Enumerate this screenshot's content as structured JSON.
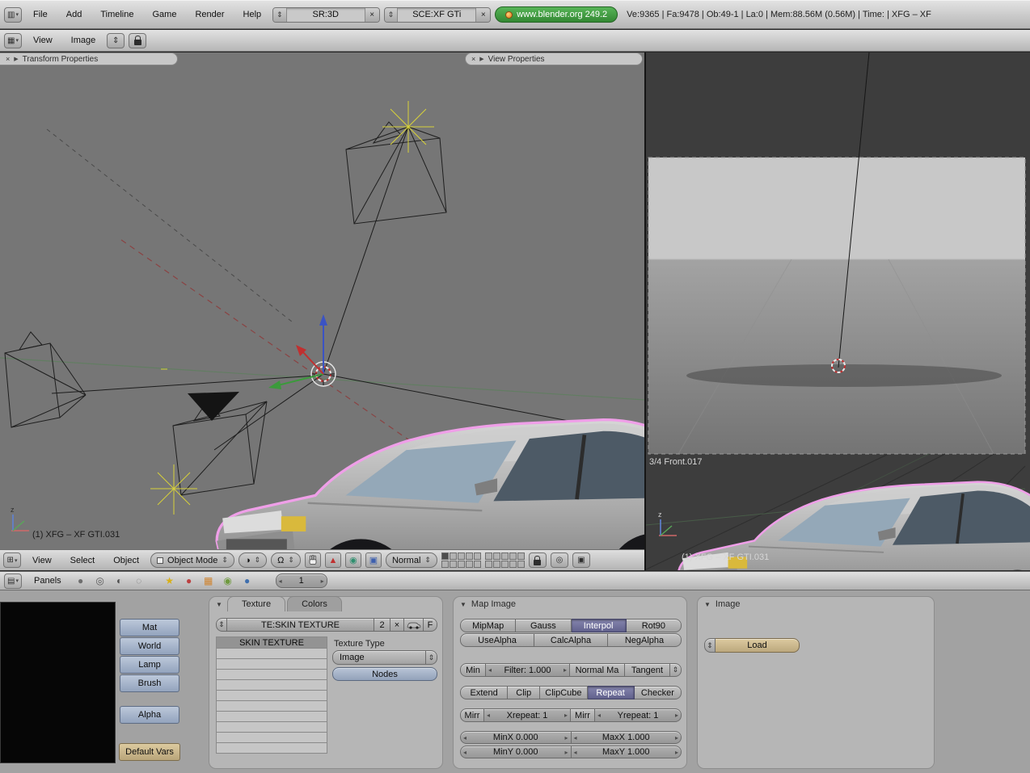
{
  "colors": {
    "header_gray": "#cfcfcf",
    "viewport_gray": "#767676",
    "image_editor_bg": "#3d3d3d",
    "buttons_area_bg": "#a2a2a2",
    "panel_bg": "#b6b6b6",
    "active_toggle": "#62628e",
    "badge_green": "#338833",
    "file_button_tan": "#c9b78e",
    "side_button_blue": "#a3b2cb",
    "selection_outline_pink": "#ef9fe8"
  },
  "icons": {
    "close": "×",
    "collapse": "▼",
    "expand": "▶",
    "stepper": "⇕",
    "dropdown": "▾",
    "info_editor": "▥",
    "image_editor": "▦",
    "view3d_editor": "⊞",
    "buttons_editor": "▤",
    "draw_type": "◑",
    "pivot": "Ω",
    "translate": "▲",
    "rotate": "◉",
    "scale": "▣",
    "proportional": "◎",
    "render_overlay": "▣",
    "logic_ctx": "●",
    "script_ctx": "◎",
    "shading_ctx": "◐",
    "object_ctx": "◌",
    "lamp_ctx": "★",
    "material_ctx": "●",
    "texture_ctx": "▦",
    "radiosity_ctx": "◉",
    "world_ctx": "●"
  },
  "top_header": {
    "menus": [
      {
        "label": "File"
      },
      {
        "label": "Add"
      },
      {
        "label": "Timeline"
      },
      {
        "label": "Game"
      },
      {
        "label": "Render"
      },
      {
        "label": "Help"
      }
    ],
    "screen_field": "SR:3D",
    "scene_field": "SCE:XF GTi",
    "version_badge": "www.blender.org 249.2",
    "stats": "Ve:9365 | Fa:9478 | Ob:49-1 | La:0 | Mem:88.56M (0.56M) | Time: | XFG – XF"
  },
  "image_header": {
    "menus": [
      {
        "label": "View"
      },
      {
        "label": "Image"
      }
    ]
  },
  "viewport3d": {
    "transform_properties_title": "Transform Properties",
    "view_properties_title": "View Properties",
    "object_label": "(1) XFG – XF GTI.031",
    "header": {
      "menus": [
        {
          "label": "View"
        },
        {
          "label": "Select"
        },
        {
          "label": "Object"
        }
      ],
      "mode": "Object Mode",
      "orientation": "Normal"
    }
  },
  "image_editor": {
    "caption": "3/4 Front.017",
    "object_label": "(1) XFG – XF GTI.031"
  },
  "buttons_header": {
    "panels_label": "Panels",
    "frame": "1"
  },
  "sidebar": {
    "buttons": [
      {
        "label": "Mat"
      },
      {
        "label": "World"
      },
      {
        "label": "Lamp"
      },
      {
        "label": "Brush"
      }
    ],
    "alpha": "Alpha",
    "default_vars": "Default Vars"
  },
  "texture_panel": {
    "tabs": [
      {
        "label": "Texture"
      },
      {
        "label": "Colors"
      }
    ],
    "datablock": {
      "name": "TE:SKIN TEXTURE",
      "users": "2",
      "fake_user": "F"
    },
    "selected_slot": "SKIN TEXTURE",
    "texture_type_label": "Texture Type",
    "texture_type": "Image",
    "nodes": "Nodes"
  },
  "map_image_panel": {
    "title": "Map Image",
    "mipmap": "MipMap",
    "gauss": "Gauss",
    "interpol": "Interpol",
    "rot90": "Rot90",
    "usealpha": "UseAlpha",
    "calcalpha": "CalcAlpha",
    "negalpha": "NegAlpha",
    "min": "Min",
    "filter": "Filter: 1.000",
    "normal_map": "Normal Ma",
    "tangent": "Tangent",
    "extend": "Extend",
    "clip": "Clip",
    "clipcube": "ClipCube",
    "repeat": "Repeat",
    "checker": "Checker",
    "mirr_x": "Mirr",
    "xrepeat": "Xrepeat: 1",
    "mirr_y": "Mirr",
    "yrepeat": "Yrepeat: 1",
    "minx": "MinX 0.000",
    "maxx": "MaxX 1.000",
    "miny": "MinY 0.000",
    "maxy": "MaxY 1.000"
  },
  "image_panel": {
    "title": "Image",
    "load": "Load"
  }
}
